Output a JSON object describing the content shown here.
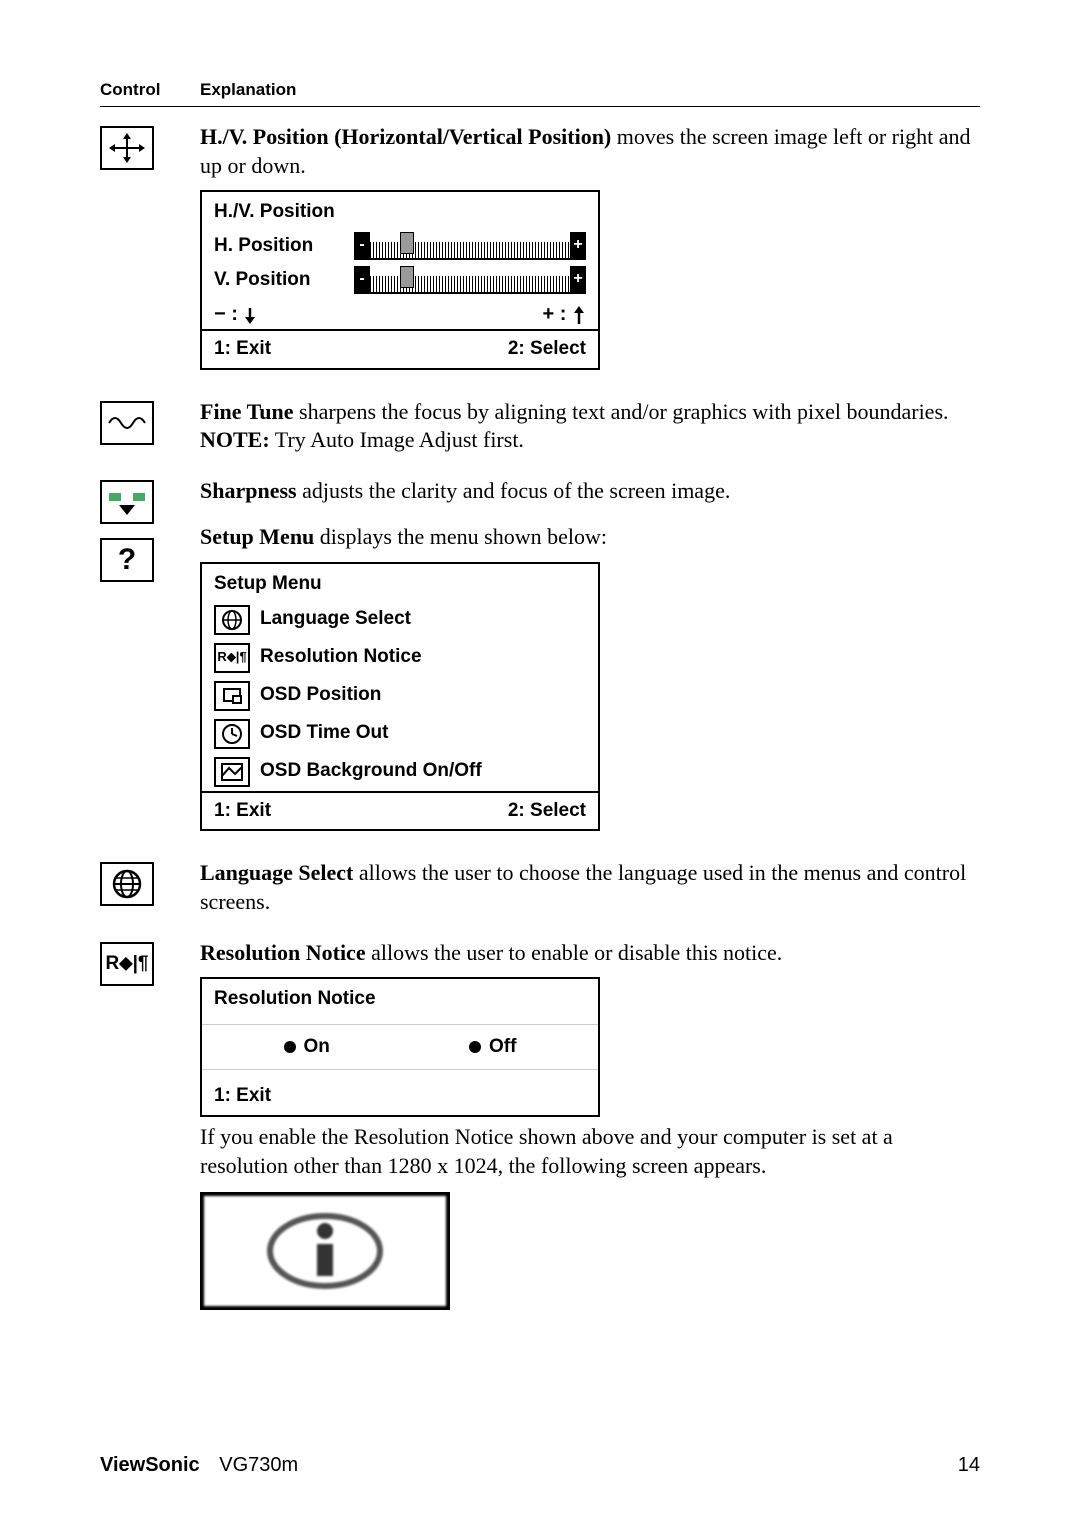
{
  "header": {
    "control": "Control",
    "explanation": "Explanation"
  },
  "hv": {
    "title_bold": "H./V. Position (Horizontal/Vertical Position)",
    "title_rest": " moves the screen image left or right and up or down.",
    "osd_title": "H./V. Position",
    "h_label": "H. Position",
    "v_label": "V. Position",
    "minus_hint": "− : ",
    "plus_hint": "+ : ",
    "exit": "1: Exit",
    "select": "2: Select"
  },
  "finetune": {
    "title_bold": "Fine Tune",
    "title_rest": " sharpens the focus by aligning text and/or graphics with pixel boundaries.",
    "note_bold": "NOTE:",
    "note_rest": " Try Auto Image Adjust first."
  },
  "sharpness": {
    "title_bold": "Sharpness",
    "title_rest": " adjusts the clarity and focus of the screen image."
  },
  "setup": {
    "title_bold": "Setup Menu",
    "title_rest": " displays the menu shown below:",
    "osd_title": "Setup Menu",
    "items": [
      "Language Select",
      "Resolution Notice",
      "OSD Position",
      "OSD Time Out",
      "OSD Background On/Off"
    ],
    "exit": "1: Exit",
    "select": "2: Select"
  },
  "language": {
    "title_bold": "Language Select",
    "title_rest": " allows the user to choose the language used in the menus and control screens."
  },
  "resolution": {
    "title_bold": "Resolution Notice",
    "title_rest": " allows the user to enable or disable this notice.",
    "osd_title": "Resolution Notice",
    "on": "On",
    "off": "Off",
    "exit": "1: Exit",
    "after_text": "If you enable the Resolution Notice shown above and your computer is set at a resolution other than 1280 x 1024, the following screen appears."
  },
  "footer": {
    "brand": "ViewSonic",
    "model": "VG730m",
    "page": "14"
  }
}
